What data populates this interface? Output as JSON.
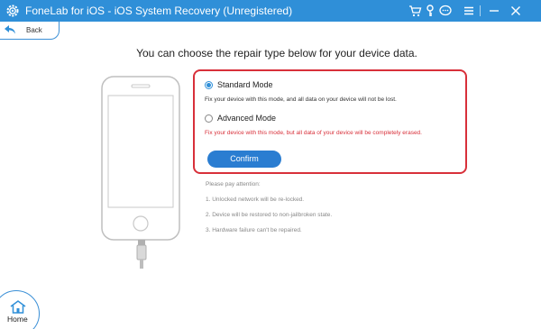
{
  "window": {
    "title": "FoneLab for iOS - iOS System Recovery (Unregistered)",
    "accent": "#2f8fd8",
    "controls": [
      "cart-icon",
      "key-icon",
      "chat-icon",
      "menu-icon",
      "minimize-icon",
      "close-icon"
    ]
  },
  "nav": {
    "back_label": "Back",
    "home_label": "Home"
  },
  "main": {
    "heading": "You can choose the repair type below for your device data.",
    "modes": [
      {
        "label": "Standard Mode",
        "selected": true,
        "desc": "Fix your device with this mode, and all data on your device will not be lost.",
        "desc_color": "#333333"
      },
      {
        "label": "Advanced Mode",
        "selected": false,
        "desc": "Fix your device with this mode, but all data of your device will be completely erased.",
        "desc_color": "#d8303a"
      }
    ],
    "confirm_label": "Confirm",
    "highlight_color": "#d8303a"
  },
  "attention": {
    "title": "Please pay attention:",
    "items": [
      "1. Unlocked network will be re-locked.",
      "2. Device will be restored to non-jailbroken state.",
      "3. Hardware failure can't be repaired."
    ]
  }
}
